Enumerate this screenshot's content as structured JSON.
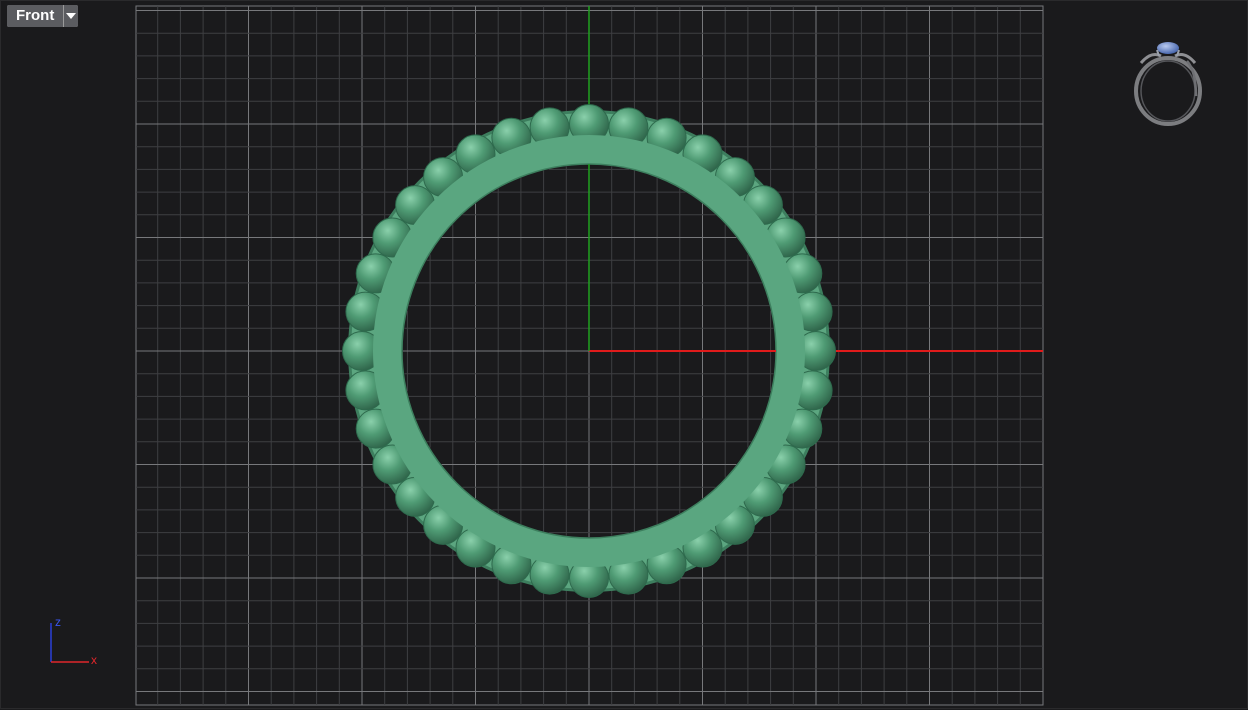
{
  "viewport": {
    "view_name": "Front",
    "dropdown_icon": "chevron-down-icon"
  },
  "axis_gizmo": {
    "x_label": "x",
    "z_label": "z",
    "x_color": "#e0262b",
    "z_color": "#2a3fd8"
  },
  "colors": {
    "background": "#1a1a1c",
    "grid_minor": "#3e3f42",
    "grid_major": "#77787b",
    "x_axis": "#e01b1b",
    "y_axis": "#1fa11f",
    "ring": "#4b9a72"
  },
  "model": {
    "name": "ring-band-with-beads",
    "bead_count": 36
  },
  "thumbnail": {
    "name": "ring-preview",
    "gem_color": "#4a6fb8"
  }
}
